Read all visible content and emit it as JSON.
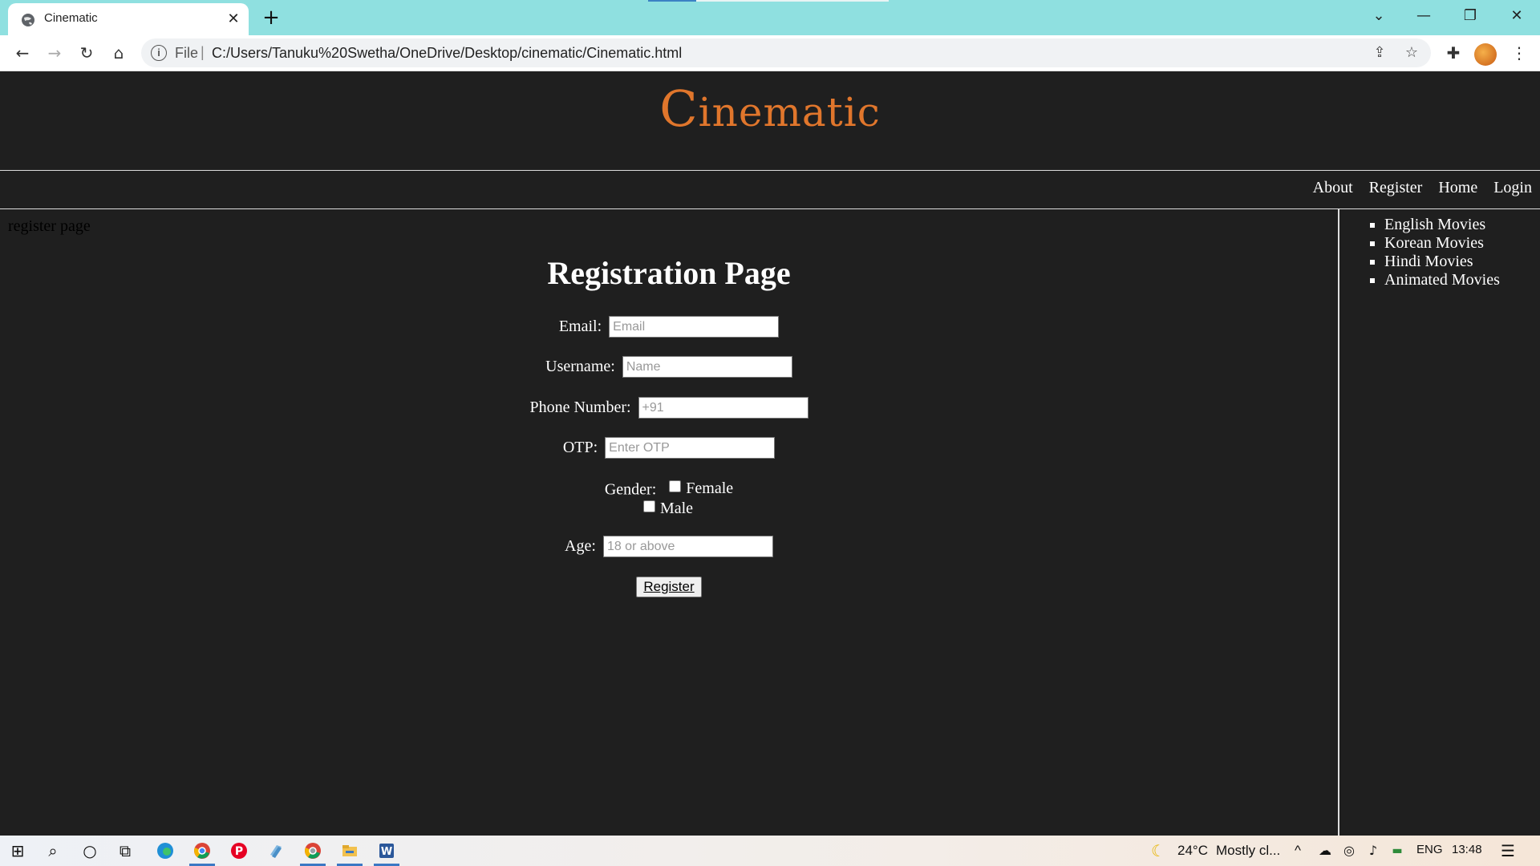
{
  "browser": {
    "tab_title": "Cinematic",
    "tab_close": "✕",
    "new_tab": "+",
    "url_scheme": "File",
    "url_separator": "|",
    "url": "C:/Users/Tanuku%20Swetha/OneDrive/Desktop/cinematic/Cinematic.html",
    "window_controls": {
      "dropdown": "⌄",
      "minimize": "—",
      "restore": "❐",
      "close": "✕"
    },
    "nav_icons": {
      "back": "←",
      "forward": "→",
      "reload": "↻",
      "home": "⌂"
    },
    "omnibox_icons": {
      "info": "i",
      "share": "⇪",
      "bookmark": "☆"
    },
    "toolbar_icons": {
      "extensions": "✚",
      "menu": "⋮"
    }
  },
  "site": {
    "logo_cap": "C",
    "logo_rest": "inematic",
    "nav": [
      "About",
      "Register",
      "Home",
      "Login"
    ],
    "page_note": "register page"
  },
  "form": {
    "heading": "Registration Page",
    "email_label": "Email:",
    "email_placeholder": "Email",
    "username_label": "Username:",
    "username_placeholder": "Name",
    "phone_label": "Phone Number:",
    "phone_placeholder": "+91",
    "otp_label": "OTP:",
    "otp_placeholder": "Enter OTP",
    "gender_label": "Gender:",
    "gender_options": [
      "Female",
      "Male"
    ],
    "age_label": "Age:",
    "age_placeholder": "18 or above",
    "submit_label": "Register"
  },
  "sidebar": {
    "items": [
      "English Movies",
      "Korean Movies",
      "Hindi Movies",
      "Animated Movies"
    ]
  },
  "taskbar": {
    "start": "⊞",
    "search": "⌕",
    "cortana": "○",
    "taskview": "⧉",
    "weather_icon": "☾",
    "temperature": "24°C",
    "weather": "Mostly cl...",
    "tray_chevron": "^",
    "language": "ENG",
    "time": "13:48",
    "notifications": "☰"
  }
}
